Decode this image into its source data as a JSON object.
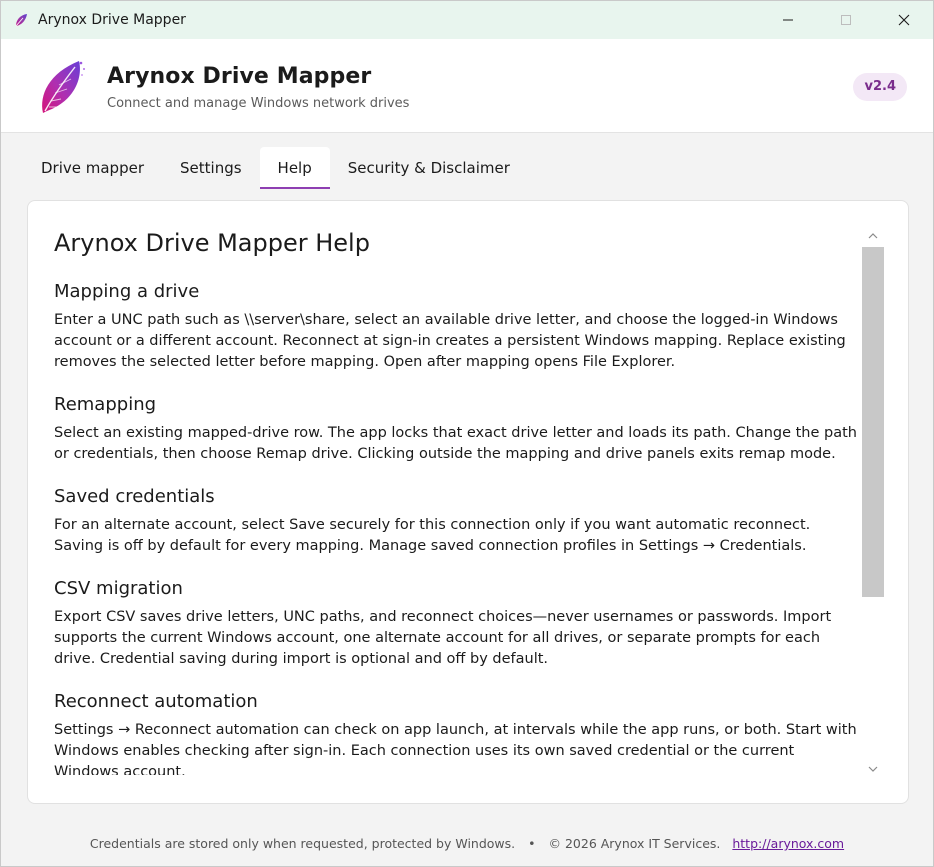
{
  "window": {
    "title": "Arynox Drive Mapper"
  },
  "header": {
    "app_name": "Arynox Drive Mapper",
    "subtitle": "Connect and manage Windows network drives",
    "version": "v2.4"
  },
  "tabs": [
    {
      "label": "Drive mapper",
      "active": false
    },
    {
      "label": "Settings",
      "active": false
    },
    {
      "label": "Help",
      "active": true
    },
    {
      "label": "Security & Disclaimer",
      "active": false
    }
  ],
  "help": {
    "title": "Arynox Drive Mapper Help",
    "sections": [
      {
        "heading": "Mapping a drive",
        "body": "Enter a UNC path such as \\\\server\\share, select an available drive letter, and choose the logged-in Windows account or a different account. Reconnect at sign-in creates a persistent Windows mapping. Replace existing removes the selected letter before mapping. Open after mapping opens File Explorer."
      },
      {
        "heading": "Remapping",
        "body": "Select an existing mapped-drive row. The app locks that exact drive letter and loads its path. Change the path or credentials, then choose Remap drive. Clicking outside the mapping and drive panels exits remap mode."
      },
      {
        "heading": "Saved credentials",
        "body": "For an alternate account, select Save securely for this connection only if you want automatic reconnect. Saving is off by default for every mapping. Manage saved connection profiles in Settings → Credentials."
      },
      {
        "heading": "CSV migration",
        "body": "Export CSV saves drive letters, UNC paths, and reconnect choices—never usernames or passwords. Import supports the current Windows account, one alternate account for all drives, or separate prompts for each drive. Credential saving during import is optional and off by default."
      },
      {
        "heading": "Reconnect automation",
        "body": "Settings → Reconnect automation can check on app launch, at intervals while the app runs, or both. Start with Windows enables checking after sign-in. Each connection uses its own saved credential or the current Windows account."
      }
    ]
  },
  "footer": {
    "note": "Credentials are stored only when requested, protected by Windows.",
    "separator": "•",
    "copyright": "© 2026 Arynox IT Services.",
    "link": "http://arynox.com"
  },
  "colors": {
    "accent": "#8e3fb2",
    "titlebar": "#e8f5ee",
    "version_badge_bg": "#f3e8f6",
    "version_badge_fg": "#7a2c8c"
  },
  "icons": {
    "app": "feather-logo-icon",
    "minimize": "minimize-icon",
    "maximize": "maximize-icon",
    "close": "close-icon",
    "scroll_up": "chevron-up-icon",
    "scroll_down": "chevron-down-icon"
  }
}
